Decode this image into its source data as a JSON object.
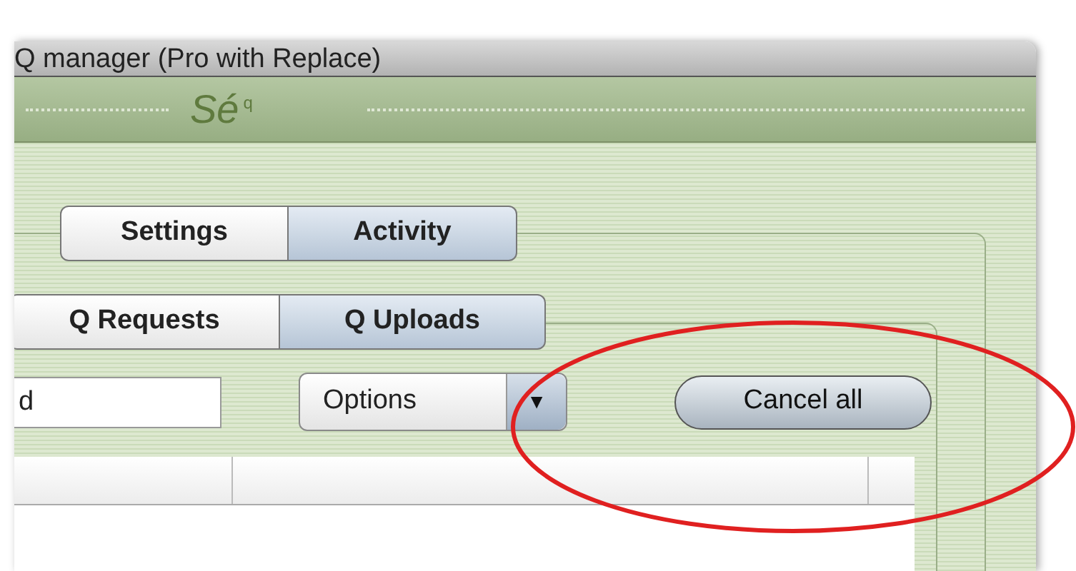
{
  "window": {
    "title": "Q manager (Pro with Replace)"
  },
  "toolbar": {
    "logo": "Sé",
    "logo_suffix": "q"
  },
  "tabs": [
    {
      "label": "Settings",
      "selected": false
    },
    {
      "label": "Activity",
      "selected": true
    }
  ],
  "subtabs": [
    {
      "label": "Q Requests",
      "selected": false
    },
    {
      "label": "Q Uploads",
      "selected": true
    }
  ],
  "filter_field": {
    "value": "d"
  },
  "options_popup": {
    "label": "Options",
    "arrow": "▼"
  },
  "cancel_button": {
    "label": "Cancel all"
  },
  "annotation": {
    "kind": "ellipse",
    "color": "#e02020"
  }
}
